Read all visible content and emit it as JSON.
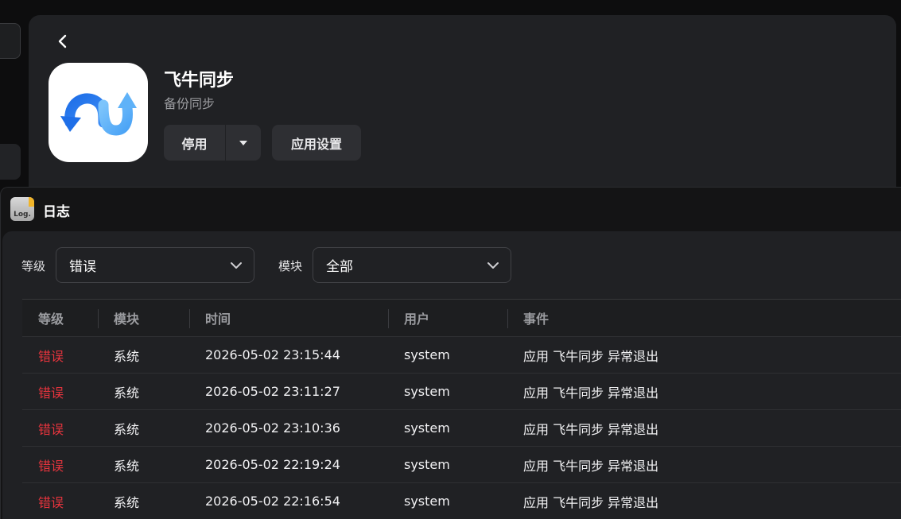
{
  "app": {
    "name": "飞牛同步",
    "category": "备份同步",
    "stop_label": "停用",
    "settings_label": "应用设置"
  },
  "log_window": {
    "title": "日志",
    "icon_text": "Log."
  },
  "filters": {
    "level_label": "等级",
    "level_value": "错误",
    "module_label": "模块",
    "module_value": "全部"
  },
  "table": {
    "columns": [
      "等级",
      "模块",
      "时间",
      "用户",
      "事件"
    ],
    "rows": [
      {
        "level": "错误",
        "module": "系统",
        "time": "2026-05-02 23:15:44",
        "user": "system",
        "event": "应用 飞牛同步 异常退出"
      },
      {
        "level": "错误",
        "module": "系统",
        "time": "2026-05-02 23:11:27",
        "user": "system",
        "event": "应用 飞牛同步 异常退出"
      },
      {
        "level": "错误",
        "module": "系统",
        "time": "2026-05-02 23:10:36",
        "user": "system",
        "event": "应用 飞牛同步 异常退出"
      },
      {
        "level": "错误",
        "module": "系统",
        "time": "2026-05-02 22:19:24",
        "user": "system",
        "event": "应用 飞牛同步 异常退出"
      },
      {
        "level": "错误",
        "module": "系统",
        "time": "2026-05-02 22:16:54",
        "user": "system",
        "event": "应用 飞牛同步 异常退出"
      }
    ]
  },
  "colors": {
    "error_level": "#e5343d",
    "accent_blue": "#2b7cf0"
  }
}
